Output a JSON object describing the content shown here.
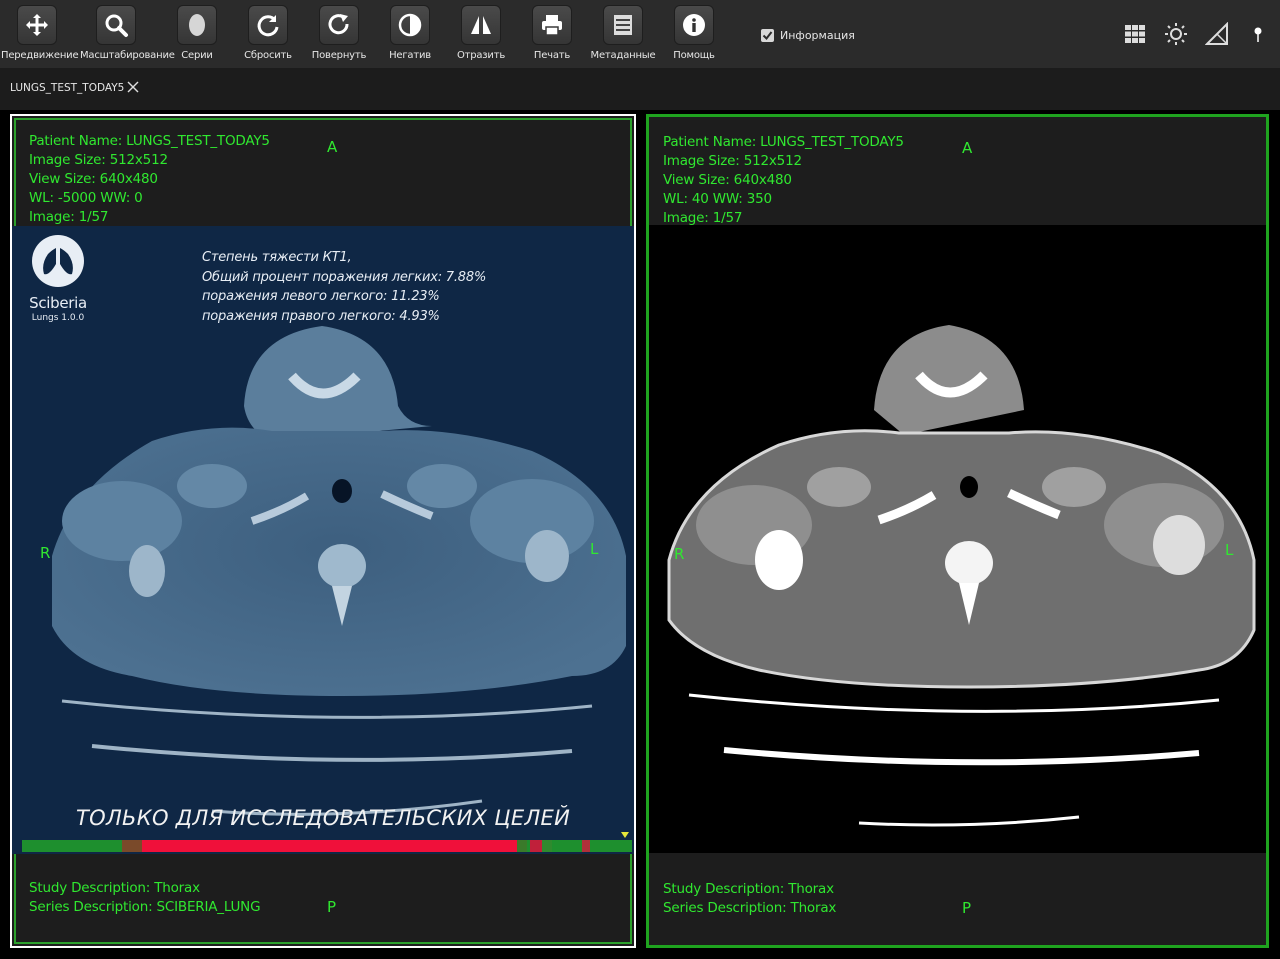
{
  "toolbar": {
    "tools": [
      {
        "id": "move",
        "label": "Передвижение",
        "icon": "move-icon"
      },
      {
        "id": "zoom",
        "label": "Масштабирование",
        "icon": "magnifier-icon"
      },
      {
        "id": "series",
        "label": "Серии",
        "icon": "series-icon"
      },
      {
        "id": "reset",
        "label": "Сбросить",
        "icon": "reset-icon"
      },
      {
        "id": "rotate",
        "label": "Повернуть",
        "icon": "rotate-icon"
      },
      {
        "id": "invert",
        "label": "Негатив",
        "icon": "negative-icon"
      },
      {
        "id": "flip",
        "label": "Отразить",
        "icon": "flip-icon"
      },
      {
        "id": "print",
        "label": "Печать",
        "icon": "printer-icon"
      },
      {
        "id": "metadata",
        "label": "Метаданные",
        "icon": "metadata-icon"
      },
      {
        "id": "help",
        "label": "Помощь",
        "icon": "info-icon"
      }
    ],
    "info_checkbox": {
      "label": "Информация",
      "checked": true
    },
    "right_icons": [
      "layout-grid-icon",
      "brightness-icon",
      "signal-icon",
      "pin-icon"
    ]
  },
  "tab": {
    "label": "LUNGS_TEST_TODAY5"
  },
  "viewports": [
    {
      "patient_name": "Patient Name: LUNGS_TEST_TODAY5",
      "image_size": "Image Size: 512x512",
      "view_size": "View Size: 640x480",
      "wl_ww": "WL: -5000  WW: 0",
      "image_index": "Image: 1/57",
      "orient_top": "A",
      "orient_bottom": "P",
      "orient_left": "R",
      "orient_right": "L",
      "study_description": "Study Description: Thorax",
      "series_description": "Series Description: SCIBERIA_LUNG",
      "logo": {
        "brand": "Sciberia",
        "version": "Lungs 1.0.0"
      },
      "analysis": [
        "Степень тяжести КТ1,",
        "Общий процент поражения легких: 7.88%",
        "поражения левого легкого: 11.23%",
        "поражения правого легкого: 4.93%"
      ],
      "disclaimer": "ТОЛЬКО ДЛЯ ИССЛЕДОВАТЕЛЬСКИХ ЦЕЛЕЙ"
    },
    {
      "patient_name": "Patient Name: LUNGS_TEST_TODAY5",
      "image_size": "Image Size: 512x512",
      "view_size": "View Size: 640x480",
      "wl_ww": "WL: 40  WW: 350",
      "image_index": "Image: 1/57",
      "orient_top": "A",
      "orient_bottom": "P",
      "orient_left": "R",
      "orient_right": "L",
      "study_description": "Study Description: Thorax",
      "series_description": "Series Description: Thorax"
    }
  ],
  "colors": {
    "overlay_text": "#30e830",
    "active_border": "#ffffff",
    "viewport_border": "#1fa31f",
    "severity_high": "#f0103a",
    "severity_low": "#1e8f2e",
    "toolbar_bg": "#2b2b2b"
  }
}
